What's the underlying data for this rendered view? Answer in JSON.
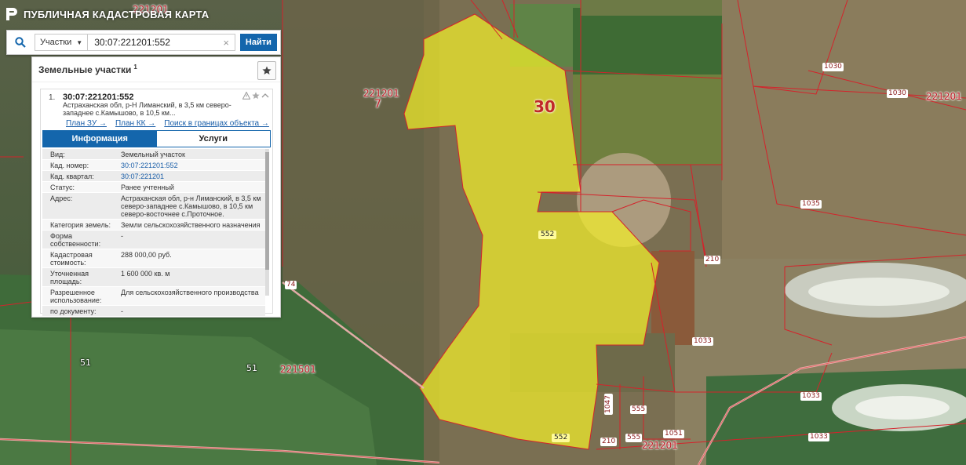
{
  "app": {
    "title": "ПУБЛИЧНАЯ КАДАСТРОВАЯ КАРТА"
  },
  "search": {
    "category": "Участки",
    "query": "30:07:221201:552",
    "clear_symbol": "×",
    "button_label": "Найти"
  },
  "results": {
    "title": "Земельные участки",
    "count": "1",
    "item": {
      "number": "1.",
      "cad_number": "30:07:221201:552",
      "address_short": "Астраханская обл, р-Н Лиманский, в 3,5 км северо-западнее с.Камышово, в 10,5 км...",
      "links": [
        "План ЗУ →",
        "План КК →",
        "Поиск в границах объекта →"
      ]
    },
    "tabs": [
      "Информация",
      "Услуги"
    ],
    "info": [
      {
        "label": "Вид:",
        "value": "Земельный участок"
      },
      {
        "label": "Кад. номер:",
        "value": "30:07:221201:552"
      },
      {
        "label": "Кад. квартал:",
        "value": "30:07:221201"
      },
      {
        "label": "Статус:",
        "value": "Ранее учтенный"
      },
      {
        "label": "Адрес:",
        "value": "Астраханская обл, р-н Лиманский, в 3,5 км северо-западнее с.Камышово, в 10,5 км северо-восточнее с.Проточное."
      },
      {
        "label": "Категория земель:",
        "value": "Земли сельскохозяйственного назначения"
      },
      {
        "label": "Форма собственности:",
        "value": "-"
      },
      {
        "label": "Кадастровая стоимость:",
        "value": "288 000,00 руб."
      },
      {
        "label": "Уточненная площадь:",
        "value": "1 600 000 кв. м"
      },
      {
        "label": "Разрешенное использование:",
        "value": "Для сельскохозяйственного производства"
      },
      {
        "label": "по документу:",
        "value": "-"
      }
    ]
  },
  "map": {
    "labels": {
      "q221201_top": "221201",
      "q221201_mid": "221201",
      "q7": "7",
      "n30": "30",
      "n1030_a": "1030",
      "n1030_b": "1030",
      "q221201_right": "221201",
      "n1035": "1035",
      "n552_mid": "552",
      "n210_a": "210",
      "n74": "74",
      "n1033_a": "1033",
      "n51_a": "51",
      "n51_b": "51",
      "q221501": "221501",
      "n1047": "1047",
      "n555_a": "555",
      "n555_b": "555",
      "n552_bottom": "552",
      "n210_b": "210",
      "n1051": "1051",
      "q221201_bottom": "221201",
      "n1033_b": "1033",
      "n1033_c": "1033"
    }
  },
  "colors": {
    "accent": "#1466ac",
    "parcel_fill": "#f2ee2a",
    "boundary": "#d4232b"
  }
}
